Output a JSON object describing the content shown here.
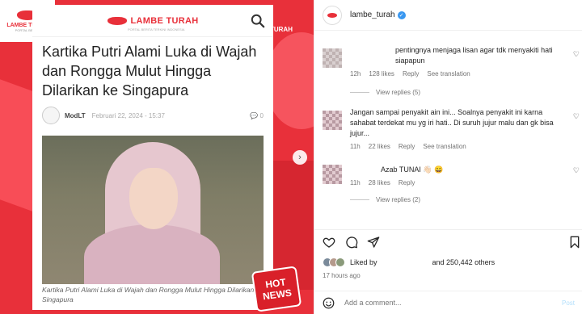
{
  "post": {
    "brand_corner": {
      "name": "LAMBE TURAH",
      "sub": "PORTAL BERITA"
    },
    "side_logo": "LAMBE TURAH",
    "card_logo": {
      "name": "LAMBE TURAH",
      "sub": "PORTAL BERITA TERKINI INDONESIA"
    },
    "article_title": "Kartika Putri Alami Luka di Wajah dan Rongga Mulut Hingga Dilarikan ke Singapura",
    "author": "ModLT",
    "date": "Februari 22, 2024 - 15:37",
    "comment_count": "0",
    "caption": "Kartika Putri Alami Luka di Wajah dan Rongga Mulut Hingga Dilarikan ke Singapura",
    "badge": "HOT NEWS",
    "next_icon": "chevron-right-icon"
  },
  "header": {
    "username": "lambe_turah",
    "verified": true
  },
  "comments": [
    {
      "text": "pentingnya menjaga lisan agar tdk menyakiti hati siapapun",
      "time": "12h",
      "likes": "128 likes",
      "reply": "Reply",
      "translation": "See translation",
      "view_replies": "View replies (5)"
    },
    {
      "text": "Jangan sampai penyakit ain ini... Soalnya penyakit ini karna sahabat terdekat mu yg iri hati.. Di suruh jujur malu dan gk bisa jujur...",
      "time": "11h",
      "likes": "22 likes",
      "reply": "Reply",
      "translation": "See translation"
    },
    {
      "text": "Azab TUNAI 👋🏻 😄",
      "time": "11h",
      "likes": "28 likes",
      "reply": "Reply",
      "view_replies": "View replies (2)"
    }
  ],
  "actions": {
    "like_icon": "heart-icon",
    "comment_icon": "comment-icon",
    "share_icon": "share-icon",
    "save_icon": "bookmark-icon"
  },
  "likes": {
    "liked_by": "Liked by",
    "others": "and 250,442 others"
  },
  "time_ago": "17 hours ago",
  "add_comment": {
    "placeholder": "Add a comment...",
    "post_label": "Post"
  }
}
